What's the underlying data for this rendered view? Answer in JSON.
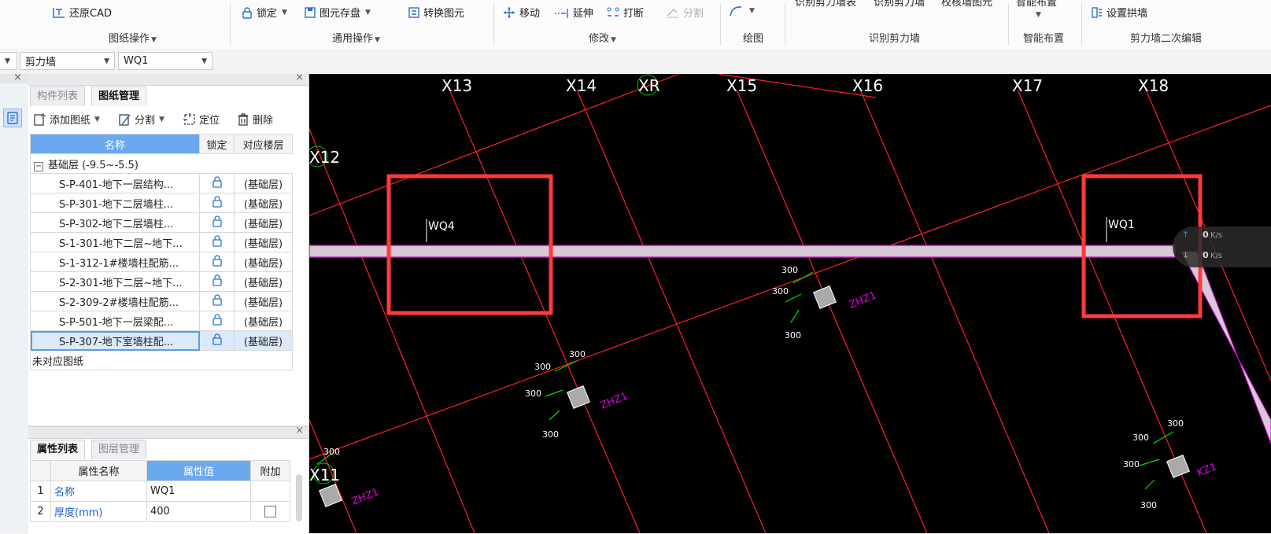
{
  "ribbon": {
    "restore_cad": "还原CAD",
    "group_drawing_ops": "图纸操作",
    "lock": "锁定",
    "element_save": "图元存盘",
    "convert_element": "转换图元",
    "group_general": "通用操作",
    "move": "移动",
    "extend": "延伸",
    "break": "打断",
    "split": "分割",
    "group_modify": "修改",
    "group_draw": "绘图",
    "identify_table": "识别剪力墙表",
    "identify_wall": "识别剪力墙",
    "verify_wall": "校核墙图元",
    "group_identify": "识别剪力墙",
    "smart_layout": "智能布置",
    "group_smart": "智能布置",
    "set_arch_wall": "设置拱墙",
    "group_secondary": "剪力墙二次编辑"
  },
  "combos": {
    "type_value": "剪力墙",
    "name_value": "WQ1"
  },
  "drawing_panel": {
    "tab_components": "构件列表",
    "tab_drawings": "图纸管理",
    "add_drawing": "添加图纸",
    "split": "分割",
    "locate": "定位",
    "delete": "删除",
    "col_name": "名称",
    "col_lock": "锁定",
    "col_floor": "对应楼层",
    "group_label": "基础层 (-9.5~-5.5)",
    "rows": [
      {
        "name": "S-P-401-地下一层结构...",
        "floor": "(基础层)"
      },
      {
        "name": "S-P-301-地下二层墙柱...",
        "floor": "(基础层)"
      },
      {
        "name": "S-P-302-地下二层墙柱...",
        "floor": "(基础层)"
      },
      {
        "name": "S-1-301-地下二层~地下...",
        "floor": "(基础层)"
      },
      {
        "name": "S-1-312-1#楼墙柱配筋...",
        "floor": "(基础层)"
      },
      {
        "name": "S-2-301-地下二层~地下...",
        "floor": "(基础层)"
      },
      {
        "name": "S-2-309-2#楼墙柱配筋...",
        "floor": "(基础层)"
      },
      {
        "name": "S-P-501-地下一层梁配...",
        "floor": "(基础层)"
      },
      {
        "name": "S-P-307-地下室墙柱配...",
        "floor": "(基础层)"
      }
    ],
    "unmatched": "未对应图纸"
  },
  "prop_panel": {
    "tab_props": "属性列表",
    "tab_layers": "图层管理",
    "col_prop_name": "属性名称",
    "col_prop_value": "属性值",
    "col_extra": "附加",
    "rows": [
      {
        "idx": "1",
        "name": "名称",
        "value": "WQ1"
      },
      {
        "idx": "2",
        "name": "厚度(mm)",
        "value": "400"
      }
    ]
  },
  "canvas": {
    "axes": [
      "X13",
      "X14",
      "XR",
      "X15",
      "X16",
      "X17",
      "X18",
      "X12",
      "X11"
    ],
    "wall_labels": [
      "WQ4",
      "WQ1"
    ],
    "dim_300": "300",
    "column_labels": [
      "ZHZ1",
      "ZHZ1",
      "ZHZ1",
      "KZ1"
    ]
  },
  "speed": {
    "up": "0",
    "down": "0",
    "unit": "K/s"
  },
  "colors": {
    "canvas_bg": "#000000",
    "grid_line": "#ff2020",
    "highlight_box": "#ff3b3b",
    "wall_fill": "#d8c8d8",
    "accent_blue": "#6aa8ef"
  }
}
